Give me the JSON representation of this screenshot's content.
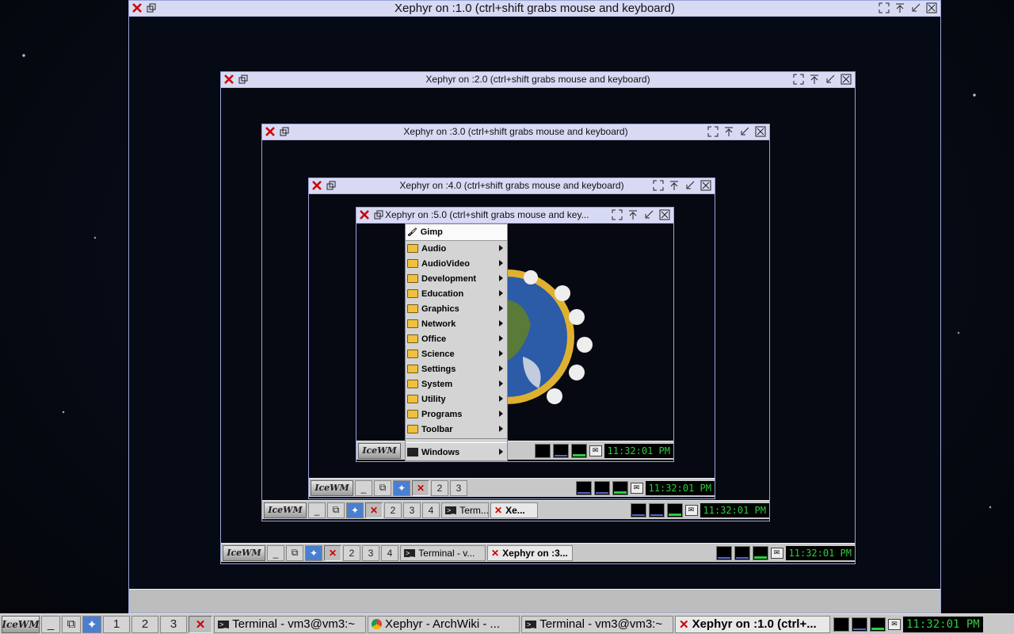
{
  "windows": {
    "w1": {
      "title": "Xephyr on :1.0 (ctrl+shift grabs mouse and keyboard)"
    },
    "w2": {
      "title": "Xephyr on :2.0 (ctrl+shift grabs mouse and keyboard)"
    },
    "w3": {
      "title": "Xephyr on :3.0 (ctrl+shift grabs mouse and keyboard)"
    },
    "w4": {
      "title": "Xephyr on :4.0 (ctrl+shift grabs mouse and keyboard)"
    },
    "w5": {
      "title": "Xephyr on :5.0 (ctrl+shift grabs mouse and key..."
    }
  },
  "logo_text": "IceWM",
  "clock": "11:32:01 PM",
  "nested_taskbars": {
    "w2": {
      "workspaces": [
        "2",
        "3",
        "4"
      ],
      "tasks": [
        "Terminal - v...",
        "Xephyr on :3..."
      ]
    },
    "w3": {
      "workspaces": [
        "2",
        "3",
        "4"
      ],
      "tasks": [
        "Term...",
        "Xe..."
      ]
    },
    "w4": {
      "workspaces": [
        "2",
        "3"
      ]
    }
  },
  "main_taskbar": {
    "workspaces": [
      "1",
      "2",
      "3"
    ],
    "tasks": [
      {
        "label": "Terminal - vm3@vm3:~",
        "icon": "terminal-icon"
      },
      {
        "label": "Xephyr - ArchWiki - ...",
        "icon": "chrome-icon"
      },
      {
        "label": "Terminal - vm3@vm3:~",
        "icon": "terminal-icon"
      },
      {
        "label": "Xephyr on :1.0 (ctrl+...",
        "icon": "x-icon",
        "active": true
      }
    ]
  },
  "menu": {
    "header": "Gimp",
    "items": [
      "Audio",
      "AudioVideo",
      "Development",
      "Education",
      "Graphics",
      "Network",
      "Office",
      "Science",
      "Settings",
      "System",
      "Utility",
      "Programs",
      "Toolbar"
    ],
    "footer": "Windows"
  },
  "colors": {
    "titlebar": "#d8daf4",
    "clock": "#2ecc40",
    "taskbar": "#c8c8c8"
  }
}
